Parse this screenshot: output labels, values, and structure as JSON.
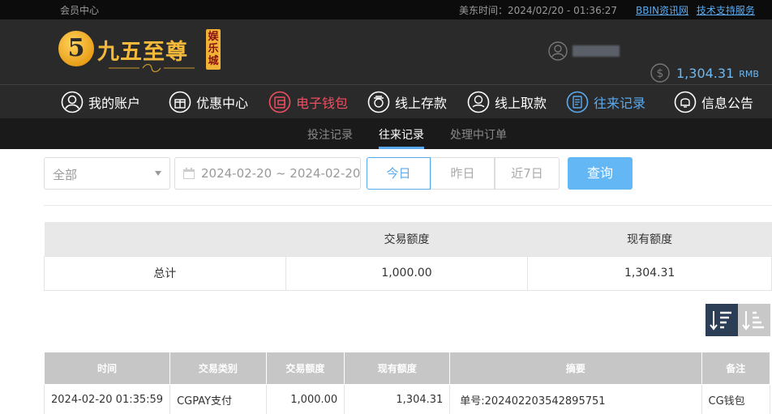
{
  "topbar": {
    "member_center": "会员中心",
    "time_text": "美东时间：2024/02/20 - 01:36:27",
    "links": [
      "BBIN资讯网",
      "技术支持服务"
    ]
  },
  "logo": {
    "number": "5",
    "name": "九五至尊",
    "badge": "娱乐城"
  },
  "account": {
    "balance": "1,304.31",
    "currency": "RMB"
  },
  "nav": [
    {
      "label": "我的账户",
      "icon": "user-icon"
    },
    {
      "label": "优惠中心",
      "icon": "gift-icon"
    },
    {
      "label": "电子钱包",
      "icon": "wallet-icon"
    },
    {
      "label": "线上存款",
      "icon": "deposit-icon"
    },
    {
      "label": "线上取款",
      "icon": "withdraw-icon"
    },
    {
      "label": "往来记录",
      "icon": "record-icon"
    },
    {
      "label": "信息公告",
      "icon": "bell-icon"
    }
  ],
  "subnav": [
    "投注记录",
    "往来记录",
    "处理中订单"
  ],
  "filters": {
    "type_selected": "全部",
    "date_range": "2024-02-20 ~ 2024-02-20",
    "quick": [
      "今日",
      "昨日",
      "近7日"
    ],
    "query": "查询"
  },
  "summary": {
    "headers": [
      "",
      "交易额度",
      "现有额度"
    ],
    "row": [
      "总计",
      "1,000.00",
      "1,304.31"
    ]
  },
  "detail": {
    "headers": [
      "时间",
      "交易类别",
      "交易额度",
      "现有额度",
      "摘要",
      "备注"
    ],
    "rows": [
      [
        "2024-02-20 01:35:59",
        "CGPAY支付",
        "1,000.00",
        "1,304.31",
        "单号:202402203542895751",
        "CG钱包"
      ]
    ]
  },
  "colors": {
    "accent": "#5aaaf0",
    "active_red": "#f04f62",
    "brand_gold": "#f4b83a"
  }
}
